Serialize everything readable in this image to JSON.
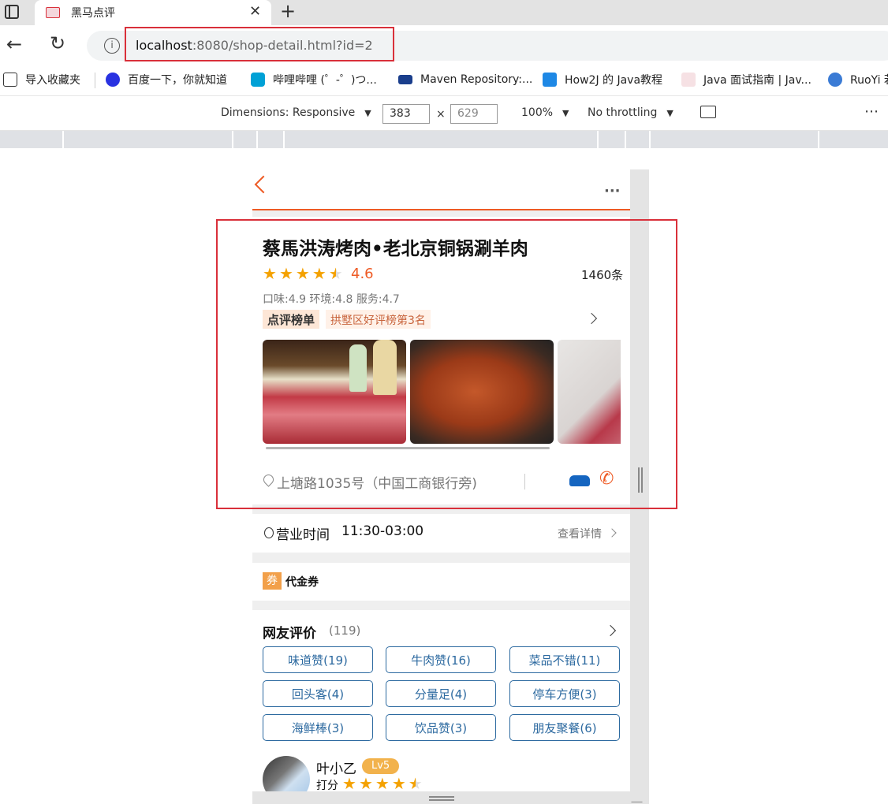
{
  "browser": {
    "tab_title": "黑马点评",
    "url_host": "localhost",
    "url_rest": ":8080/shop-detail.html?id=2",
    "bookmarks": [
      {
        "label": "导入收藏夹",
        "color": "#333333"
      },
      {
        "label": "百度一下，你就知道",
        "color": "#2932e1"
      },
      {
        "label": "哔哩哔哩 (゜-゜)つ...",
        "color": "#00a1d6"
      },
      {
        "label": "Maven Repository:...",
        "color": "#1a3e8c"
      },
      {
        "label": "How2J 的 Java教程",
        "color": "#1e88e5"
      },
      {
        "label": "Java 面试指南 | Jav...",
        "color": "#e04050"
      },
      {
        "label": "RuoYi 若",
        "color": "#3a7bd5"
      }
    ]
  },
  "devtools": {
    "dimensions": "Dimensions: Responsive",
    "width_value": "383",
    "times": "×",
    "height_value": "629",
    "zoom": "100%",
    "throttling": "No throttling",
    "more": "⋯"
  },
  "shop": {
    "name": "蔡馬洪涛烤肉•老北京铜锅涮羊肉",
    "score": "4.6",
    "score_stars": 4.5,
    "comments_count": "1460条",
    "sub_scores": "口味:4.9 环境:4.8 服务:4.7",
    "rank_badge": "点评榜单",
    "rank_text": "拱墅区好评榜第3名",
    "address": "上塘路1035号（中国工商银行旁)",
    "hours_label": "营业时间",
    "hours_value": "11:30-03:00",
    "hours_detail": "查看详情",
    "coupon_badge": "券",
    "coupon_title": "代金券"
  },
  "reviews": {
    "title": "网友评价",
    "count": "(119)",
    "tags": [
      "味道赞(19)",
      "牛肉赞(16)",
      "菜品不错(11)",
      "回头客(4)",
      "分量足(4)",
      "停车方便(3)",
      "海鲜棒(3)",
      "饮品赞(3)",
      "朋友聚餐(6)"
    ],
    "first_user": {
      "name": "叶小乙",
      "level": "Lv5",
      "rating_label": "打分",
      "stars": 4.5
    }
  },
  "colors": {
    "accent_orange": "#ee5a24",
    "tag_blue": "#2d6aa0",
    "star_yellow": "#f4a100",
    "highlight_red": "#d9303a"
  }
}
